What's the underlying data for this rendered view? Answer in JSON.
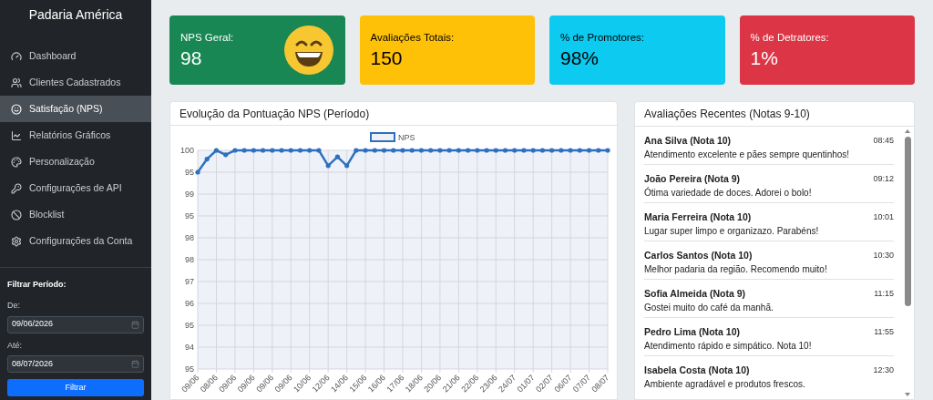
{
  "sidebar": {
    "brand": "Padaria América",
    "items": [
      {
        "label": "Dashboard",
        "selected": false
      },
      {
        "label": "Clientes Cadastrados",
        "selected": false
      },
      {
        "label": "Satisfação (NPS)",
        "selected": true
      },
      {
        "label": "Relatórios Gráficos",
        "selected": false
      },
      {
        "label": "Personalização",
        "selected": false
      },
      {
        "label": "Configurações de API",
        "selected": false
      },
      {
        "label": "Blocklist",
        "selected": false
      },
      {
        "label": "Configurações da Conta",
        "selected": false
      }
    ],
    "filter": {
      "title": "Filtrar Período:",
      "fields": [
        {
          "label": "De:",
          "value": "09/06/2026"
        },
        {
          "label": "Até:",
          "value": "08/07/2026"
        }
      ],
      "button": "Filtrar"
    }
  },
  "cards": [
    {
      "label": "NPS Geral:",
      "value": "98",
      "color": "#198754",
      "kind": "smiley"
    },
    {
      "label": "Avaliações Totais:",
      "value": "150",
      "color": "#ffc107",
      "kind": "plain"
    },
    {
      "label": "% de Promotores:",
      "value": "98%",
      "color": "#0dcaf0",
      "kind": "plain"
    },
    {
      "label": "% de Detratores:",
      "value": "1%",
      "color": "#dc3545",
      "kind": "plain"
    }
  ],
  "chart_panel": {
    "title": "Evolução da Pontuação NPS (Período)",
    "legend": "NPS",
    "y_axis_labels": [
      "100",
      "95",
      "99",
      "95",
      "98",
      "98",
      "97",
      "96",
      "95",
      "94",
      "95"
    ],
    "x_axis_labels": [
      "09/06",
      "08/06",
      "09/06",
      "09/06",
      "09/06",
      "09/06",
      "10/06",
      "12/06",
      "14/06",
      "15/06",
      "16/06",
      "17/06",
      "18/06",
      "20/06",
      "21/06",
      "22/06",
      "23/06",
      "24/07",
      "01/07",
      "02/07",
      "06/07",
      "07/07",
      "08/07"
    ]
  },
  "reviews_panel": {
    "title": "Avaliações Recentes (Notas 9-10)",
    "reviews": [
      {
        "name": "Ana Silva (Nota 10)",
        "time": "08:45",
        "text": "Atendimento excelente e pães sempre quentinhos!"
      },
      {
        "name": "João Pereira (Nota 9)",
        "time": "09:12",
        "text": "Ótima variedade de doces. Adorei o bolo!"
      },
      {
        "name": "Maria Ferreira (Nota 10)",
        "time": "10:01",
        "text": "Lugar super limpo e organizazo. Parabéns!"
      },
      {
        "name": "Carlos Santos (Nota 10)",
        "time": "10:30",
        "text": "Melhor padaria da região. Recomendo muito!"
      },
      {
        "name": "Sofia Almeida (Nota 9)",
        "time": "11:15",
        "text": "Gostei muito do café da manhã."
      },
      {
        "name": "Pedro Lima (Nota 10)",
        "time": "11:55",
        "text": "Atendimento rápido e simpático. Nota 10!"
      },
      {
        "name": "Isabela Costa (Nota 10)",
        "time": "12:30",
        "text": "Ambiente agradável e produtos frescos."
      }
    ]
  }
}
